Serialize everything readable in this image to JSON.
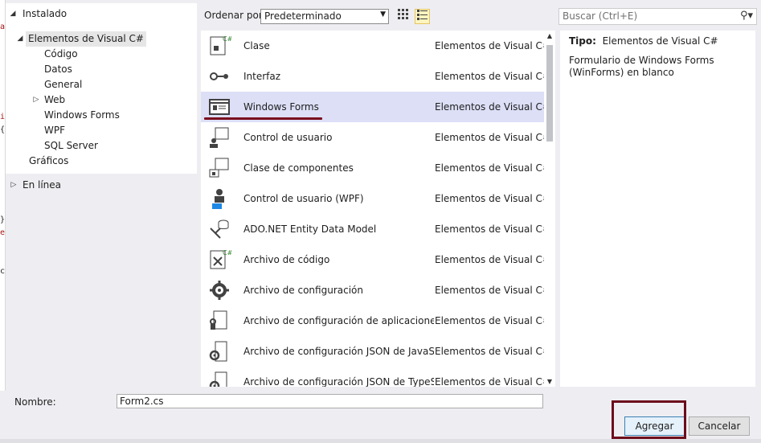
{
  "tree": {
    "installed": "Instalado",
    "csharp_items": "Elementos de Visual C#",
    "children": [
      "Código",
      "Datos",
      "General",
      "Web",
      "Windows Forms",
      "WPF",
      "SQL Server"
    ],
    "graphics": "Gráficos",
    "online": "En línea"
  },
  "toolbar": {
    "sort_label": "Ordenar por:",
    "sort_value": "Predeterminado",
    "search_placeholder": "Buscar (Ctrl+E)"
  },
  "templates": [
    {
      "name": "Clase",
      "category": "Elementos de Visual C#",
      "icon": "class-icon"
    },
    {
      "name": "Interfaz",
      "category": "Elementos de Visual C#",
      "icon": "interface-icon"
    },
    {
      "name": "Windows Forms",
      "category": "Elementos de Visual C#",
      "icon": "windows-form-icon",
      "selected": true
    },
    {
      "name": "Control de usuario",
      "category": "Elementos de Visual C#",
      "icon": "user-control-icon"
    },
    {
      "name": "Clase de componentes",
      "category": "Elementos de Visual C#",
      "icon": "component-class-icon"
    },
    {
      "name": "Control de usuario (WPF)",
      "category": "Elementos de Visual C#",
      "icon": "wpf-user-control-icon"
    },
    {
      "name": "ADO.NET Entity Data Model",
      "category": "Elementos de Visual C#",
      "icon": "entity-model-icon"
    },
    {
      "name": "Archivo de código",
      "category": "Elementos de Visual C#",
      "icon": "code-file-icon"
    },
    {
      "name": "Archivo de configuración",
      "category": "Elementos de Visual C#",
      "icon": "config-file-icon"
    },
    {
      "name": "Archivo de configuración de aplicaciones",
      "category": "Elementos de Visual C#",
      "icon": "app-config-icon"
    },
    {
      "name": "Archivo de configuración JSON de JavaScript",
      "category": "Elementos de Visual C#",
      "icon": "json-config-icon"
    },
    {
      "name": "Archivo de configuración JSON de TypeScript",
      "category": "Elementos de Visual C#",
      "icon": "json-config-icon"
    }
  ],
  "details": {
    "type_label": "Tipo:",
    "type_value": "Elementos de Visual C#",
    "description": "Formulario de Windows Forms (WinForms) en blanco"
  },
  "footer": {
    "name_label": "Nombre:",
    "name_value": "Form2.cs",
    "add_label": "Agregar",
    "cancel_label": "Cancelar"
  },
  "colors": {
    "selection": "#dcdff6",
    "annotation": "#7a0e1d",
    "accent": "#3c7fb1"
  }
}
